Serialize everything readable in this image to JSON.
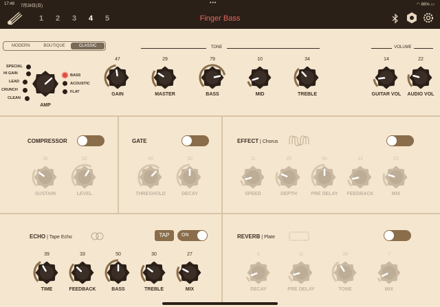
{
  "status": {
    "time": "17:48",
    "date": "7月28日(日)",
    "battery": "86%"
  },
  "tabs": [
    "1",
    "2",
    "3",
    "4",
    "5"
  ],
  "active_tab": "4",
  "title": "Finger Bass",
  "amp": {
    "modes": [
      "MODERN",
      "BOUTIQUE",
      "CLASSIC"
    ],
    "selected_mode": "CLASSIC",
    "types": [
      "SPECIAL",
      "HI GAIN",
      "LEAD",
      "CRUNCH",
      "CLEAN"
    ],
    "type_label": "AMP",
    "channels": [
      "BASS",
      "ACOUSTIC",
      "FLAT"
    ],
    "selected_channel": "BASS"
  },
  "tone_group": "TONE",
  "volume_group": "VOLUME",
  "amp_knobs": [
    {
      "label": "GAIN",
      "value": "47",
      "level": 0.47
    },
    {
      "label": "MASTER",
      "value": "29",
      "level": 0.29
    },
    {
      "label": "BASS",
      "value": "79",
      "level": 0.79
    },
    {
      "label": "MID",
      "value": "10",
      "level": 0.1
    },
    {
      "label": "TREBLE",
      "value": "34",
      "level": 0.34
    },
    {
      "label": "GUITAR VOL",
      "value": "14",
      "level": 0.14
    },
    {
      "label": "AUDIO VOL",
      "value": "22",
      "level": 0.22
    }
  ],
  "compressor": {
    "title": "COMPRESSOR",
    "enabled": false,
    "knobs": [
      {
        "label": "SUSTAIN",
        "value": "30",
        "level": 0.3
      },
      {
        "label": "LEVEL",
        "value": "62",
        "level": 0.62
      }
    ]
  },
  "gate": {
    "title": "GATE",
    "enabled": false,
    "knobs": [
      {
        "label": "THRESHOLD",
        "value": "66",
        "level": 0.66
      },
      {
        "label": "DECAY",
        "value": "50",
        "level": 0.5
      }
    ]
  },
  "effect": {
    "title": "EFFECT",
    "type": "Chorus",
    "enabled": false,
    "knobs": [
      {
        "label": "SPEED",
        "value": "11",
        "level": 0.11
      },
      {
        "label": "DEPTH",
        "value": "25",
        "level": 0.25
      },
      {
        "label": "PRE DELAY",
        "value": "50",
        "level": 0.5
      },
      {
        "label": "FEEDBACK",
        "value": "12",
        "level": 0.12
      },
      {
        "label": "MIX",
        "value": "23",
        "level": 0.23
      }
    ]
  },
  "echo": {
    "title": "ECHO",
    "type": "Tape Echo",
    "tap_label": "TAP",
    "on_label": "ON",
    "enabled": true,
    "knobs": [
      {
        "label": "TIME",
        "value": "39",
        "level": 0.39
      },
      {
        "label": "FEEDBACK",
        "value": "33",
        "level": 0.33
      },
      {
        "label": "BASS",
        "value": "50",
        "level": 0.5
      },
      {
        "label": "TREBLE",
        "value": "30",
        "level": 0.3
      },
      {
        "label": "MIX",
        "value": "27",
        "level": 0.27
      }
    ]
  },
  "reverb": {
    "title": "REVERB",
    "type": "Plate",
    "enabled": false,
    "knobs": [
      {
        "label": "DECAY",
        "value": "9",
        "level": 0.09
      },
      {
        "label": "PRE DELAY",
        "value": "11",
        "level": 0.11
      },
      {
        "label": "TONE",
        "value": "38",
        "level": 0.38
      },
      {
        "label": "MIX",
        "value": "7",
        "level": 0.07
      }
    ]
  }
}
